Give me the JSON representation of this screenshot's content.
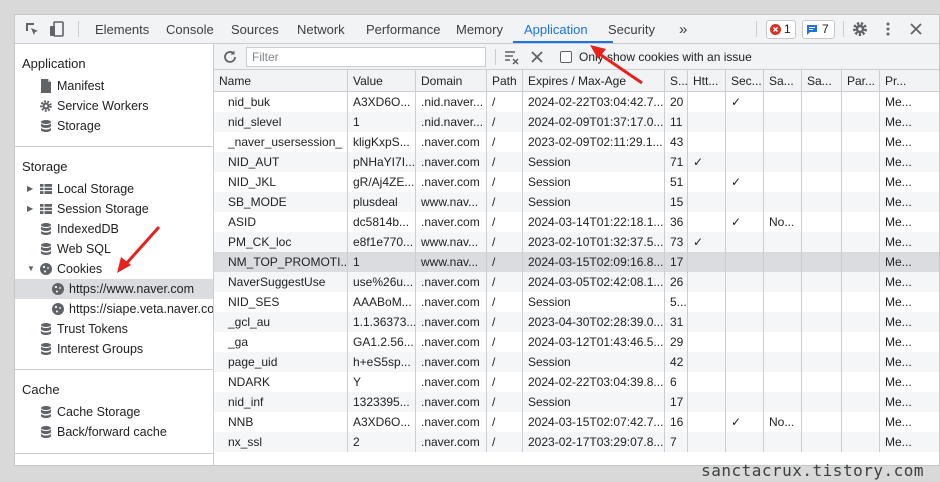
{
  "toolbar": {
    "tabs": [
      "Elements",
      "Console",
      "Sources",
      "Network",
      "Performance",
      "Memory",
      "Application",
      "Security"
    ],
    "more": "»",
    "errors": "1",
    "messages": "7",
    "icons": [
      "inspect-icon",
      "device-toggle-icon",
      "gear-icon",
      "kebab-menu-icon",
      "close-icon"
    ],
    "accent": "#1a73e8",
    "error_color": "#d93025"
  },
  "sidebar": {
    "application_heading": "Application",
    "application_items": [
      "Manifest",
      "Service Workers",
      "Storage"
    ],
    "storage_heading": "Storage",
    "storage_items": [
      "Local Storage",
      "Session Storage",
      "IndexedDB",
      "Web SQL",
      "Cookies"
    ],
    "cookie_sites": [
      "https://www.naver.com",
      "https://siape.veta.naver.com"
    ],
    "storage_items_2": [
      "Trust Tokens",
      "Interest Groups"
    ],
    "cache_heading": "Cache",
    "cache_items": [
      "Cache Storage",
      "Back/forward cache"
    ]
  },
  "filterbar": {
    "placeholder": "Filter",
    "only_issue_label": "Only show cookies with an issue"
  },
  "table": {
    "columns": [
      "Name",
      "Value",
      "Domain",
      "Path",
      "Expires / Max-Age",
      "S...",
      "Htt...",
      "Sec...",
      "Sa...",
      "Sa...",
      "Par...",
      "Pr..."
    ],
    "rows": [
      [
        "nid_buk",
        "A3XD6O...",
        ".nid.naver...",
        "/",
        "2024-02-22T03:04:42.7...",
        "20",
        "",
        "✓",
        "",
        "",
        "",
        "Me..."
      ],
      [
        "nid_slevel",
        "1",
        ".nid.naver...",
        "/",
        "2024-02-09T01:37:17.0...",
        "11",
        "",
        "",
        "",
        "",
        "",
        "Me..."
      ],
      [
        "_naver_usersession_",
        "kligKxpS...",
        ".naver.com",
        "/",
        "2023-02-09T02:11:29.1...",
        "43",
        "",
        "",
        "",
        "",
        "",
        "Me..."
      ],
      [
        "NID_AUT",
        "pNHaYI7I...",
        ".naver.com",
        "/",
        "Session",
        "71",
        "✓",
        "",
        "",
        "",
        "",
        "Me..."
      ],
      [
        "NID_JKL",
        "gR/Aj4ZE...",
        ".naver.com",
        "/",
        "Session",
        "51",
        "",
        "✓",
        "",
        "",
        "",
        "Me..."
      ],
      [
        "SB_MODE",
        "plusdeal",
        "www.nav...",
        "/",
        "Session",
        "15",
        "",
        "",
        "",
        "",
        "",
        "Me..."
      ],
      [
        "ASID",
        "dc5814b...",
        ".naver.com",
        "/",
        "2024-03-14T01:22:18.1...",
        "36",
        "",
        "✓",
        "No...",
        "",
        "",
        "Me..."
      ],
      [
        "PM_CK_loc",
        "e8f1e770...",
        "www.nav...",
        "/",
        "2023-02-10T01:32:37.5...",
        "73",
        "✓",
        "",
        "",
        "",
        "",
        "Me..."
      ],
      [
        "NM_TOP_PROMOTI...",
        "1",
        "www.nav...",
        "/",
        "2024-03-15T02:09:16.8...",
        "17",
        "",
        "",
        "",
        "",
        "",
        "Me..."
      ],
      [
        "NaverSuggestUse",
        "use%26u...",
        ".naver.com",
        "/",
        "2024-03-05T02:42:08.1...",
        "26",
        "",
        "",
        "",
        "",
        "",
        "Me..."
      ],
      [
        "NID_SES",
        "AAABoM...",
        ".naver.com",
        "/",
        "Session",
        "5...",
        "",
        "",
        "",
        "",
        "",
        "Me..."
      ],
      [
        "_gcl_au",
        "1.1.36373...",
        ".naver.com",
        "/",
        "2023-04-30T02:28:39.0...",
        "31",
        "",
        "",
        "",
        "",
        "",
        "Me..."
      ],
      [
        "_ga",
        "GA1.2.56...",
        ".naver.com",
        "/",
        "2024-03-12T01:43:46.5...",
        "29",
        "",
        "",
        "",
        "",
        "",
        "Me..."
      ],
      [
        "page_uid",
        "h+eS5sp...",
        ".naver.com",
        "/",
        "Session",
        "42",
        "",
        "",
        "",
        "",
        "",
        "Me..."
      ],
      [
        "NDARK",
        "Y",
        ".naver.com",
        "/",
        "2024-02-22T03:04:39.8...",
        "6",
        "",
        "",
        "",
        "",
        "",
        "Me..."
      ],
      [
        "nid_inf",
        "1323395...",
        ".naver.com",
        "/",
        "Session",
        "17",
        "",
        "",
        "",
        "",
        "",
        "Me..."
      ],
      [
        "NNB",
        "A3XD6O...",
        ".naver.com",
        "/",
        "2024-03-15T02:07:42.7...",
        "16",
        "",
        "✓",
        "No...",
        "",
        "",
        "Me..."
      ],
      [
        "nx_ssl",
        "2",
        ".naver.com",
        "/",
        "2023-02-17T03:29:07.8...",
        "7",
        "",
        "",
        "",
        "",
        "",
        "Me..."
      ]
    ],
    "selected_row": 8
  },
  "annotation_color": "#e8211b",
  "watermark": "sanctacrux.tistory.com"
}
